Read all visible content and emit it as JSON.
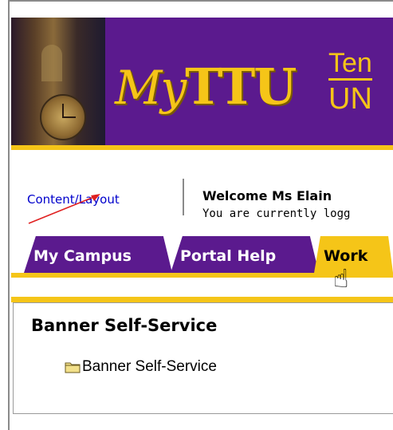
{
  "banner": {
    "logo_text_my": "My",
    "logo_text_ttu": "TTU",
    "side_line1": "Ten",
    "side_line2": "UN"
  },
  "header": {
    "content_layout_link": "Content/Layout",
    "welcome_text": "Welcome Ms Elain",
    "logged_text": "You are currently logg"
  },
  "tabs": [
    {
      "label": "My Campus"
    },
    {
      "label": "Portal Help"
    },
    {
      "label": "Work"
    }
  ],
  "panel": {
    "title": "Banner Self-Service",
    "items": [
      {
        "label": "Banner Self-Service",
        "icon": "folder-icon"
      }
    ]
  },
  "colors": {
    "purple": "#5b1a8e",
    "gold": "#f5c518",
    "link": "#0000cc",
    "annotation_arrow": "#e02020"
  }
}
